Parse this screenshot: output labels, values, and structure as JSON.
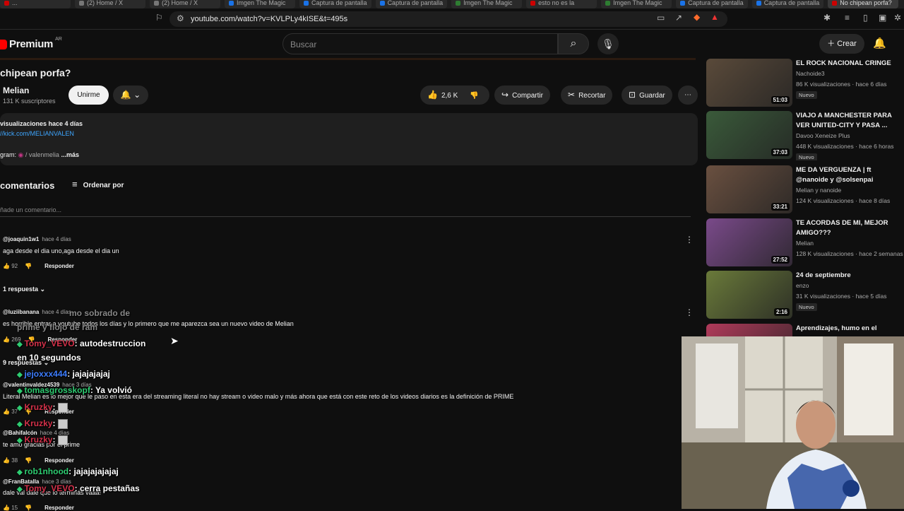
{
  "browser": {
    "tabs": [
      {
        "label": "...",
        "color": "#c00"
      },
      {
        "label": "(2) Home / X",
        "color": "#777"
      },
      {
        "label": "(2) Home / X",
        "color": "#777"
      },
      {
        "label": "Imgen The Magic",
        "color": "#1a73e8"
      },
      {
        "label": "Captura de pantalla",
        "color": "#1a73e8"
      },
      {
        "label": "Captura de pantalla",
        "color": "#1a73e8"
      },
      {
        "label": "Imgen The Magic",
        "color": "#2e7d32"
      },
      {
        "label": "esto no es la",
        "color": "#c00"
      },
      {
        "label": "Imgen The Magic",
        "color": "#2e7d32"
      },
      {
        "label": "Captura de pantalla",
        "color": "#1a73e8"
      },
      {
        "label": "Captura de pantalla",
        "color": "#1a73e8"
      },
      {
        "label": "No chipean porfa?",
        "color": "#c00"
      }
    ],
    "url": "youtube.com/watch?v=KVLPLy4kISE&t=495s"
  },
  "header": {
    "logo_text": "Premium",
    "logo_country": "AR",
    "search_placeholder": "Buscar",
    "create_label": "Crear"
  },
  "video": {
    "title": "chipean porfa?",
    "channel": "Melian",
    "subscribers": "131 K suscriptores",
    "join_label": "Unirme",
    "likes": "2,6 K",
    "share_label": "Compartir",
    "clip_label": "Recortar",
    "save_label": "Guardar"
  },
  "description": {
    "stats": "visualizaciones  hace 4 días",
    "link": "//kick.com/MELIANVALEN",
    "ig_prefix": "gram:",
    "ig_handle": "/ valenmelia",
    "more": "...más"
  },
  "comments": {
    "heading": "comentarios",
    "sort_label": "Ordenar por",
    "add_placeholder": "ñade un comentario...",
    "items": [
      {
        "author": "@joaquin1w1",
        "time": "hace 4 días",
        "text": "aga desde el dia uno,aga desde el dia un",
        "likes": "92",
        "reply": "Responder",
        "replies": "1 respuesta"
      },
      {
        "author": "@luziibanana",
        "time": "hace 4 días",
        "text": "es horrible entrar a youtube todos los días y lo primero que me aparezca sea un nuevo video de Melian",
        "likes": "269",
        "reply": "Responder",
        "replies": "9 respuestas"
      },
      {
        "author": "@valentinvaldez4539",
        "time": "hace 3 días",
        "text": "Literal Melian es lo mejor que le paso en esta era del streaming literal no hay stream o video malo y más ahora que está con este reto de los videos diarios es la definición de PRIME",
        "likes": "37",
        "reply": "Responder"
      },
      {
        "author": "@Bahifalcón",
        "time": "hace 4 días",
        "text": "te amo gracias por el prime",
        "likes": "38",
        "reply": "Responder"
      },
      {
        "author": "@FranBatalla",
        "time": "hace 3 días",
        "text": "dale val dale que lo terminás vaaa!",
        "likes": "15",
        "reply": "Responder"
      }
    ]
  },
  "chat_overlay": [
    {
      "user": "",
      "msg": "mo sobrado de",
      "color": "#888"
    },
    {
      "user": "",
      "msg": "prime y flojo de ram",
      "color": "#888"
    },
    {
      "user": "Tomy_VEVO",
      "msg": ": autodestruccion",
      "user_color": "#d4314a"
    },
    {
      "user": "",
      "msg": "en 10 segundos",
      "user_color": "#fff"
    },
    {
      "user": "jejoxxx444",
      "msg": ": jajajajajaj",
      "user_color": "#3d7dff"
    },
    {
      "user": "tomasgrosskopf",
      "msg": ": Ya volvió",
      "user_color": "#2ecc71"
    },
    {
      "user": "Kruzky",
      "msg": ":",
      "user_color": "#d4314a"
    },
    {
      "user": "Kruzky",
      "msg": ":",
      "user_color": "#d4314a"
    },
    {
      "user": "Kruzky",
      "msg": ":",
      "user_color": "#d4314a"
    },
    {
      "user": "rob1nhood",
      "msg": ": jajajajajajaj",
      "user_color": "#2ecc71"
    },
    {
      "user": "Tomy_VEVO",
      "msg": ": cerra pestañas",
      "user_color": "#d4314a"
    }
  ],
  "sidebar": [
    {
      "title": "EL ROCK NACIONAL CRINGE",
      "channel": "Nachoide3",
      "meta": "86 K visualizaciones · hace 6 días",
      "badge": "Nuevo",
      "duration": "51:03",
      "thumb": "#5a4a3a"
    },
    {
      "title": "VIAJO A MANCHESTER PARA VER UNITED-CITY Y PASA ...",
      "channel": "Davoo Xeneize Plus",
      "meta": "448 K visualizaciones · hace 6 horas",
      "badge": "Nuevo",
      "duration": "37:03",
      "thumb": "#3a5a3a"
    },
    {
      "title": "ME DA VERGUENZA | ft @nanoide y @solsenpai",
      "channel": "Melian y nanoide",
      "meta": "124 K visualizaciones · hace 8 días",
      "badge": "",
      "duration": "33:21",
      "thumb": "#6a5040"
    },
    {
      "title": "TE ACORDAS DE MI, MEJOR AMIGO???",
      "channel": "Melian",
      "meta": "128 K visualizaciones · hace 2 semanas",
      "badge": "",
      "duration": "27:52",
      "thumb": "#7a4a8a"
    },
    {
      "title": "24 de septiembre",
      "channel": "enzo",
      "meta": "31 K visualizaciones · hace 5 días",
      "badge": "Nuevo",
      "duration": "2:16",
      "thumb": "#6a7a3a"
    },
    {
      "title": "Aprendizajes, humo en el",
      "channel": "",
      "meta": "",
      "badge": "",
      "duration": "",
      "thumb": "#b03a5a"
    }
  ]
}
